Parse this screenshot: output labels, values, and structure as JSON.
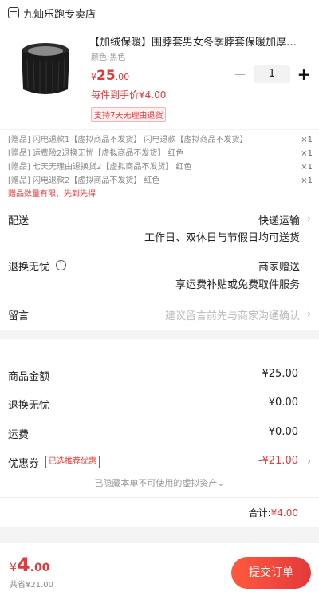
{
  "shop": {
    "name": "九灿乐跑专卖店"
  },
  "product": {
    "title": "【加绒保暖】围脖套男女冬季脖套保暖加厚…",
    "spec": "颜色:黑色",
    "price_symbol": "¥",
    "price_int": "25",
    "price_dec": ".00",
    "quantity": "1",
    "per_item": "每件到手价¥4.00",
    "return_tag": "支持7天无理由退货"
  },
  "gifts": {
    "items": [
      {
        "text": "[赠品] 闪电退款1【虚拟商品不发货】 闪电退款【虚拟商品不发货】",
        "count": "×1"
      },
      {
        "text": "[赠品] 运费险2退换无忧【虚拟商品不发货】 红色",
        "count": "×1"
      },
      {
        "text": "[赠品] 七天无理由退换货2【虚拟商品不发货】 红色",
        "count": "×1"
      },
      {
        "text": "[赠品] 闪电退款2【虚拟商品不发货】 红色",
        "count": "×1"
      }
    ],
    "note": "赠品数量有限，先到先得"
  },
  "delivery": {
    "label": "配送",
    "value": "快递运输",
    "sub": "工作日、双休日与节假日均可送货"
  },
  "returns": {
    "label": "退换无忧",
    "value": "商家赠送",
    "sub": "享运费补贴或免费取件服务"
  },
  "memo": {
    "label": "留言",
    "placeholder": "建议留言前先与商家沟通确认"
  },
  "summary": {
    "goods_label": "商品金额",
    "goods_value": "¥25.00",
    "returns_label": "退换无忧",
    "returns_value": "¥0.00",
    "shipping_label": "运费",
    "shipping_value": "¥0.00",
    "coupon_label": "优惠券",
    "coupon_tag": "已选推荐优惠",
    "coupon_value": "-¥21.00",
    "hidden_note": "已隐藏本单不可使用的虚拟资产",
    "total_label": "合计:",
    "total_value": "¥4.00"
  },
  "bottom": {
    "price_symbol": "¥",
    "price_int": "4",
    "price_dec": ".00",
    "saved": "共省¥21.00",
    "submit": "提交订单"
  },
  "colors": {
    "accent": "#e4393c"
  }
}
